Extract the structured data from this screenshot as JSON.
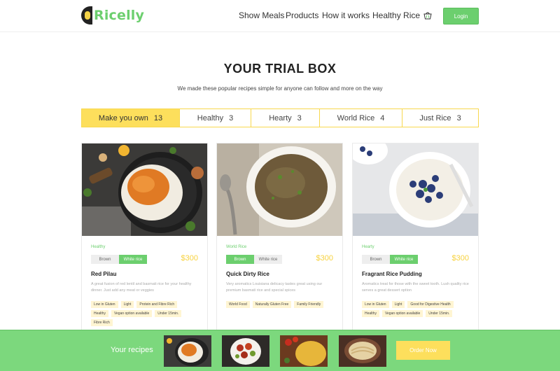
{
  "header": {
    "logo_text": "Ricelly",
    "nav": [
      "Show Meals",
      "Products",
      "How it works",
      "Healthy Rice"
    ],
    "login_label": "Login"
  },
  "main": {
    "title": "YOUR TRIAL BOX",
    "subtitle": "We made these popular recipes simple for anyone can follow and more on the way"
  },
  "tabs": [
    {
      "label": "Make you own",
      "count": "13"
    },
    {
      "label": "Healthy",
      "count": "3"
    },
    {
      "label": "Hearty",
      "count": "3"
    },
    {
      "label": "World Rice",
      "count": "4"
    },
    {
      "label": "Just Rice",
      "count": "3"
    }
  ],
  "cards": [
    {
      "category": "Healthy",
      "options": [
        "Brown",
        "White rice"
      ],
      "selected": "White rice",
      "price": "$300",
      "title": "Red Pilau",
      "description": "A great fusion of red lentil and basmati rice for your healthy dinner. Just add any meat or veggies",
      "tags": [
        "Low in Gluten",
        "Light",
        "Protein and Fibre Rich",
        "Healthy",
        "Vegan option available",
        "Under 15min.",
        "Fibre Rich"
      ]
    },
    {
      "category": "World Rice",
      "options": [
        "Brown",
        "White rice"
      ],
      "selected": "Brown",
      "price": "$300",
      "title": "Quick Dirty Rice",
      "description": "Very aromatics Louisiana delicacy tastes great using our premium basmati rice and special spices",
      "tags": [
        "World Food",
        "Naturally Gluten Free",
        "Family Friendly"
      ]
    },
    {
      "category": "Hearty",
      "options": [
        "Brown",
        "White rice"
      ],
      "selected": "White rice",
      "price": "$300",
      "title": "Fragrant Rice Pudding",
      "description": "Aromatics treat for those with the sweet tooth. Lush quality rice serves a great dessert option",
      "tags": [
        "Low in Gluten",
        "Light",
        "Good for Digestive Health",
        "Healthy",
        "Vegan option available",
        "Under 15min."
      ]
    }
  ],
  "bottom_bar": {
    "label": "Your recipes",
    "order_label": "Order Now"
  },
  "colors": {
    "brand_green": "#6ccf6e",
    "accent_yellow": "#fddf5c",
    "price_yellow": "#f7d23e"
  }
}
